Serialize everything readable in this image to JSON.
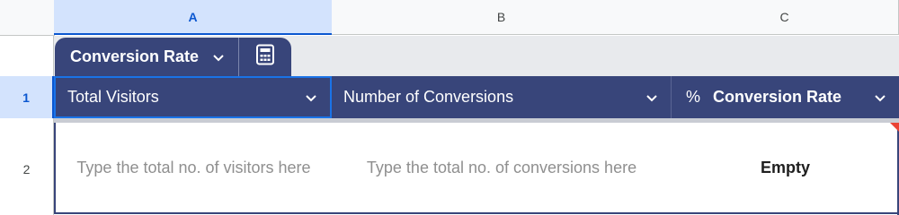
{
  "column_headers": [
    "A",
    "B",
    "C"
  ],
  "row_numbers": [
    "1",
    "2"
  ],
  "table": {
    "name": "Conversion Rate",
    "name_icon": "chevron-down-icon",
    "calculator_icon": "calculator-icon"
  },
  "header_row": {
    "columns": [
      {
        "label": "Total Visitors",
        "icon": "chevron-down-icon"
      },
      {
        "label": "Number of Conversions",
        "icon": "chevron-down-icon"
      },
      {
        "label": "Conversion Rate",
        "type_symbol": "%",
        "icon": "chevron-down-icon"
      }
    ]
  },
  "data_row": {
    "cells": [
      {
        "placeholder": "Type the total no. of visitors here"
      },
      {
        "placeholder": "Type the total no. of conversions here"
      },
      {
        "value": "Empty"
      }
    ]
  },
  "colors": {
    "table_header_bg": "#38457a",
    "selected_blue": "#0b57d0",
    "placeholder_gray": "#8f8f8f",
    "comment_flag": "#ea4335"
  }
}
